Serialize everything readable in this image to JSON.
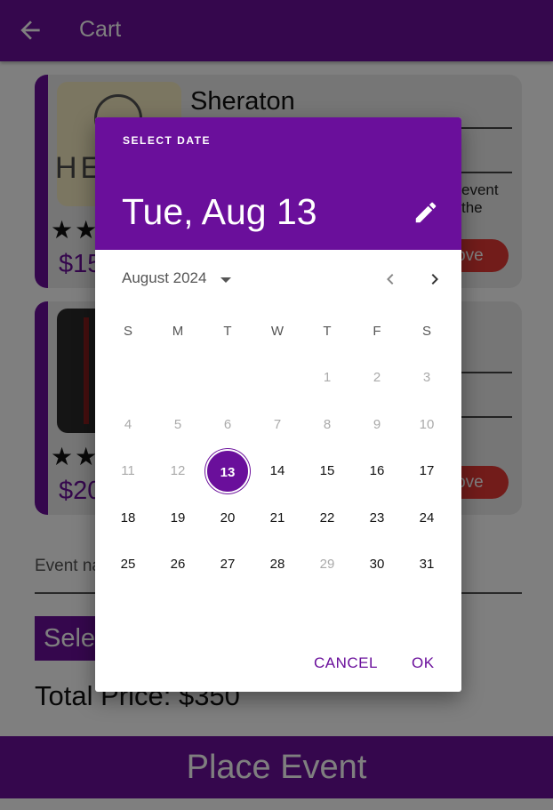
{
  "appbar": {
    "title": "Cart"
  },
  "cart": {
    "items": [
      {
        "name": "Sheraton",
        "price": "$15",
        "logo": "HE",
        "desc": "event the",
        "remove": "move",
        "stars": "★★"
      },
      {
        "name": "",
        "price": "$20",
        "remove": "move",
        "stars": "★★"
      }
    ],
    "event_name_placeholder": "Event na",
    "select_button": "Sele",
    "total": "Total Price: $350",
    "place_button": "Place Event"
  },
  "datepicker": {
    "help_text": "SELECT DATE",
    "headline": "Tue, Aug 13",
    "month_label": "August 2024",
    "weekdays": [
      "S",
      "M",
      "T",
      "W",
      "T",
      "F",
      "S"
    ],
    "weeks": [
      [
        "",
        "",
        "",
        "",
        "1",
        "2",
        "3"
      ],
      [
        "4",
        "5",
        "6",
        "7",
        "8",
        "9",
        "10"
      ],
      [
        "11",
        "12",
        "13",
        "14",
        "15",
        "16",
        "17"
      ],
      [
        "18",
        "19",
        "20",
        "21",
        "22",
        "23",
        "24"
      ],
      [
        "25",
        "26",
        "27",
        "28",
        "29",
        "30",
        "31"
      ]
    ],
    "disabled_days": [
      "1",
      "2",
      "3",
      "4",
      "5",
      "6",
      "7",
      "8",
      "9",
      "10",
      "11",
      "12",
      "29"
    ],
    "selected_day": "13",
    "cancel_label": "CANCEL",
    "ok_label": "OK"
  },
  "colors": {
    "primary": "#6a0f9b",
    "danger": "#e53935"
  }
}
